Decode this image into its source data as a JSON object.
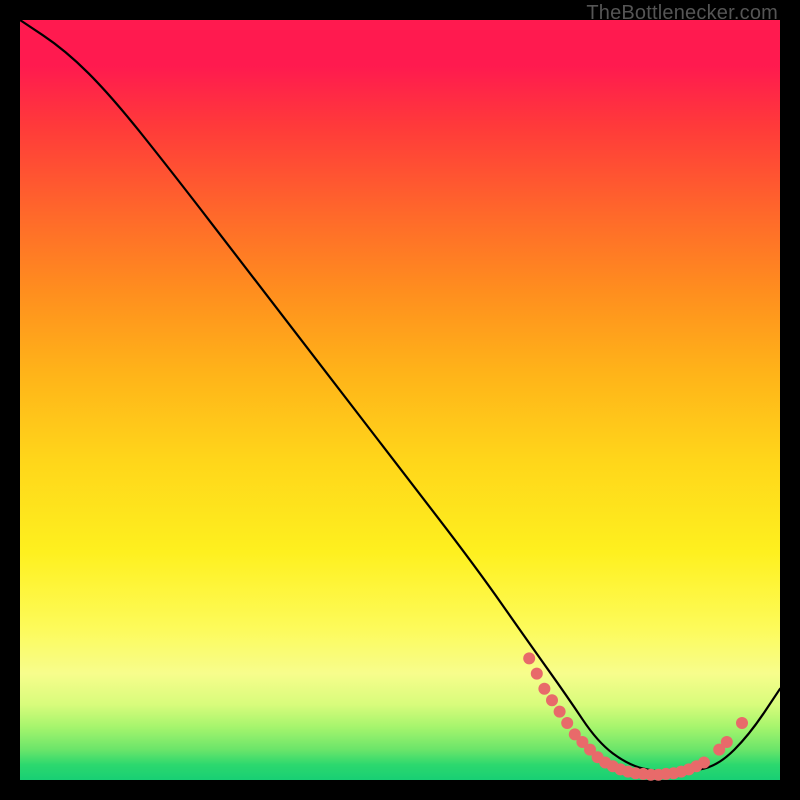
{
  "watermark": "TheBottleneсker.com",
  "chart_data": {
    "type": "line",
    "title": "",
    "xlabel": "",
    "ylabel": "",
    "xlim": [
      0,
      100
    ],
    "ylim": [
      0,
      100
    ],
    "grid": false,
    "legend": false,
    "background": "gradient-red-to-green",
    "series": [
      {
        "name": "bottleneck-curve",
        "color": "#000000",
        "x": [
          0,
          6,
          12,
          20,
          30,
          40,
          50,
          60,
          67,
          72,
          76,
          80,
          84,
          88,
          92,
          96,
          100
        ],
        "y": [
          100,
          96,
          90,
          80,
          67,
          54,
          41,
          28,
          18,
          11,
          5,
          2,
          1,
          1,
          2,
          6,
          12
        ]
      }
    ],
    "markers": [
      {
        "name": "fit-points",
        "color": "#e86a6a",
        "radius_px": 6,
        "points": [
          {
            "x": 67,
            "y": 16
          },
          {
            "x": 68,
            "y": 14
          },
          {
            "x": 69,
            "y": 12
          },
          {
            "x": 70,
            "y": 10.5
          },
          {
            "x": 71,
            "y": 9
          },
          {
            "x": 72,
            "y": 7.5
          },
          {
            "x": 73,
            "y": 6
          },
          {
            "x": 74,
            "y": 5
          },
          {
            "x": 75,
            "y": 4
          },
          {
            "x": 76,
            "y": 3
          },
          {
            "x": 77,
            "y": 2.3
          },
          {
            "x": 78,
            "y": 1.8
          },
          {
            "x": 79,
            "y": 1.4
          },
          {
            "x": 80,
            "y": 1.1
          },
          {
            "x": 81,
            "y": 0.9
          },
          {
            "x": 82,
            "y": 0.8
          },
          {
            "x": 83,
            "y": 0.7
          },
          {
            "x": 84,
            "y": 0.7
          },
          {
            "x": 85,
            "y": 0.8
          },
          {
            "x": 86,
            "y": 0.9
          },
          {
            "x": 87,
            "y": 1.1
          },
          {
            "x": 88,
            "y": 1.4
          },
          {
            "x": 89,
            "y": 1.8
          },
          {
            "x": 90,
            "y": 2.3
          },
          {
            "x": 92,
            "y": 4.0
          },
          {
            "x": 93,
            "y": 5.0
          },
          {
            "x": 95,
            "y": 7.5
          }
        ]
      }
    ]
  }
}
